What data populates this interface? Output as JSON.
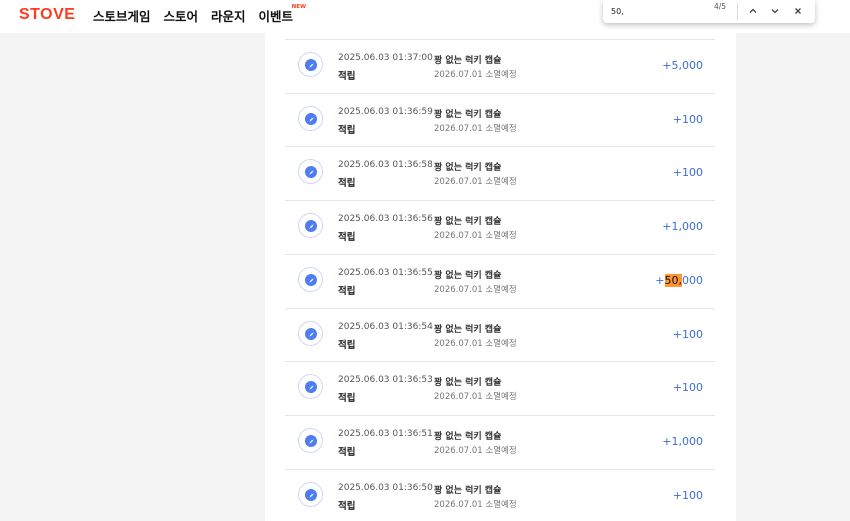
{
  "header": {
    "logo": "STOVE",
    "nav": [
      {
        "label": "스토브게임"
      },
      {
        "label": "스토어"
      },
      {
        "label": "라운지"
      },
      {
        "label": "이벤트",
        "badge": "NEW"
      }
    ]
  },
  "find_bar": {
    "query": "50,",
    "count": "4/5",
    "prev_icon": "chevron-up-icon",
    "next_icon": "chevron-down-icon",
    "close_icon": "close-icon"
  },
  "colors": {
    "brand": "#ff3a1d",
    "amount": "#3d6ed6",
    "highlight": "#ff9632"
  },
  "history": {
    "rows": [
      {
        "date": "2025.06.03 01:37:00",
        "type": "적립",
        "name": "꽝 없는 럭키 캡슐",
        "expire": "2026.07.01 소멸예정",
        "amount": "+5,000"
      },
      {
        "date": "2025.06.03 01:36:59",
        "type": "적립",
        "name": "꽝 없는 럭키 캡슐",
        "expire": "2026.07.01 소멸예정",
        "amount": "+100"
      },
      {
        "date": "2025.06.03 01:36:58",
        "type": "적립",
        "name": "꽝 없는 럭키 캡슐",
        "expire": "2026.07.01 소멸예정",
        "amount": "+100"
      },
      {
        "date": "2025.06.03 01:36:56",
        "type": "적립",
        "name": "꽝 없는 럭키 캡슐",
        "expire": "2026.07.01 소멸예정",
        "amount": "+1,000"
      },
      {
        "date": "2025.06.03 01:36:55",
        "type": "적립",
        "name": "꽝 없는 럭키 캡슐",
        "expire": "2026.07.01 소멸예정",
        "amount": "+50,000",
        "amount_parts": [
          "+",
          "50,",
          "000"
        ]
      },
      {
        "date": "2025.06.03 01:36:54",
        "type": "적립",
        "name": "꽝 없는 럭키 캡슐",
        "expire": "2026.07.01 소멸예정",
        "amount": "+100"
      },
      {
        "date": "2025.06.03 01:36:53",
        "type": "적립",
        "name": "꽝 없는 럭키 캡슐",
        "expire": "2026.07.01 소멸예정",
        "amount": "+100"
      },
      {
        "date": "2025.06.03 01:36:51",
        "type": "적립",
        "name": "꽝 없는 럭키 캡슐",
        "expire": "2026.07.01 소멸예정",
        "amount": "+1,000"
      },
      {
        "date": "2025.06.03 01:36:50",
        "type": "적립",
        "name": "꽝 없는 럭키 캡슐",
        "expire": "2026.07.01 소멸예정",
        "amount": "+100"
      }
    ]
  }
}
